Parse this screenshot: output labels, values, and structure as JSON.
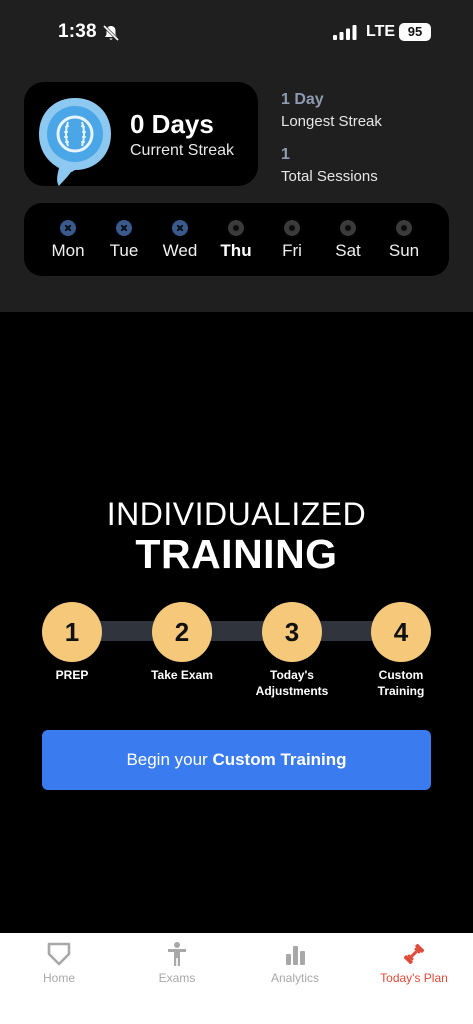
{
  "status_bar": {
    "time": "1:38",
    "network": "LTE",
    "battery": "95"
  },
  "streak": {
    "current_value": "0 Days",
    "current_label": "Current Streak",
    "longest_value": "1 Day",
    "longest_label": "Longest Streak",
    "total_value": "1",
    "total_label": "Total Sessions"
  },
  "week": {
    "days": [
      {
        "label": "Mon",
        "state": "done"
      },
      {
        "label": "Tue",
        "state": "done"
      },
      {
        "label": "Wed",
        "state": "done"
      },
      {
        "label": "Thu",
        "state": "pending",
        "today": true
      },
      {
        "label": "Fri",
        "state": "pending"
      },
      {
        "label": "Sat",
        "state": "pending"
      },
      {
        "label": "Sun",
        "state": "pending"
      }
    ]
  },
  "hero": {
    "line1": "INDIVIDUALIZED",
    "line2": "TRAINING"
  },
  "steps": [
    {
      "number": "1",
      "label_lines": [
        "PREP"
      ]
    },
    {
      "number": "2",
      "label_lines": [
        "Take Exam"
      ]
    },
    {
      "number": "3",
      "label_lines": [
        "Today's",
        "Adjustments"
      ]
    },
    {
      "number": "4",
      "label_lines": [
        "Custom",
        "Training"
      ]
    }
  ],
  "cta": {
    "prefix": "Begin your ",
    "emphasis": "Custom Training"
  },
  "tabs": [
    {
      "label": "Home",
      "icon": "home-plate-icon"
    },
    {
      "label": "Exams",
      "icon": "person-icon"
    },
    {
      "label": "Analytics",
      "icon": "bar-chart-icon"
    },
    {
      "label": "Today's Plan",
      "icon": "dumbbell-icon",
      "active": true
    }
  ],
  "colors": {
    "accent_blue": "#3a7bf0",
    "step_yellow": "#f5c87a",
    "active_tab_red": "#e04a3a",
    "badge_blue": "#8cc8f0"
  }
}
